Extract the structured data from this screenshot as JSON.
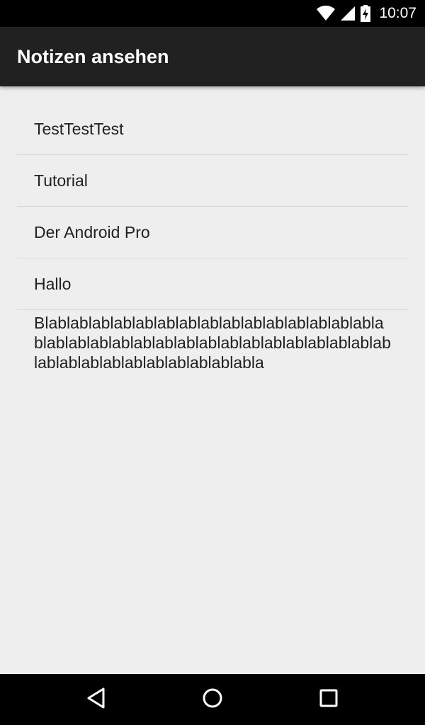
{
  "status_bar": {
    "time": "10:07",
    "icons": [
      "wifi-icon",
      "signal-icon",
      "battery-charging-icon"
    ]
  },
  "app_bar": {
    "title": "Notizen ansehen"
  },
  "notes": [
    "TestTestTest",
    "Tutorial",
    "Der Android Pro",
    "Hallo",
    "Blablablablablablablablablablablablablablablablablablablablablablablablablablablablablablablablablablablablablablablablablablabla"
  ],
  "nav_bar": {
    "buttons": [
      "back-icon",
      "home-icon",
      "recent-apps-icon"
    ]
  },
  "colors": {
    "status_bar": "#000000",
    "app_bar": "#212121",
    "background": "#eeeeee",
    "divider": "#d6d6d6",
    "text": "#212121"
  }
}
